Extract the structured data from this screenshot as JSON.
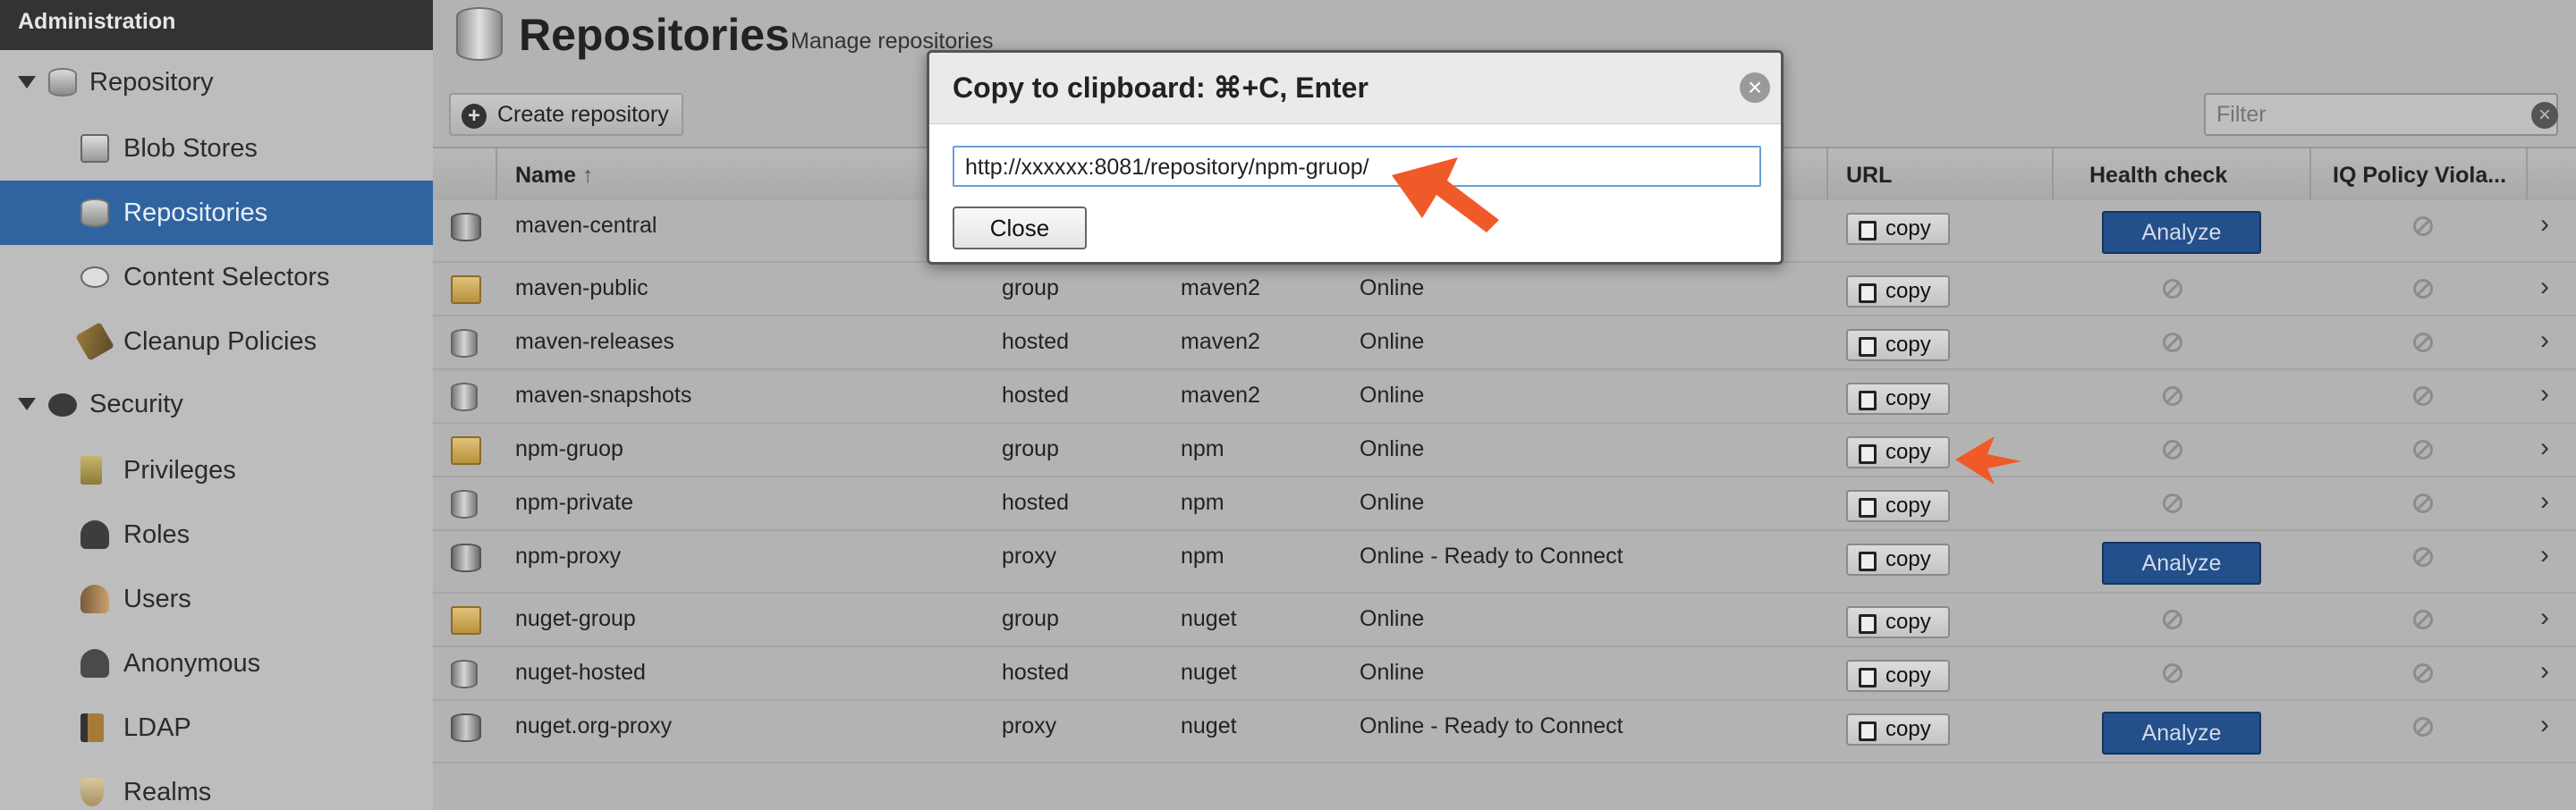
{
  "sidebar": {
    "header": "Administration",
    "repository_group": "Repository",
    "items_repo": [
      "Blob Stores",
      "Repositories",
      "Content Selectors",
      "Cleanup Policies"
    ],
    "security_group": "Security",
    "items_security": [
      "Privileges",
      "Roles",
      "Users",
      "Anonymous",
      "LDAP",
      "Realms"
    ]
  },
  "page": {
    "title": "Repositories",
    "subtitle": "Manage repositories",
    "create_button": "Create repository",
    "filter_placeholder": "Filter"
  },
  "grid": {
    "headers": {
      "name": "Name",
      "url": "URL",
      "health": "Health check",
      "iq": "IQ Policy Viola..."
    },
    "copy_label": "copy",
    "analyze_label": "Analyze",
    "rows": [
      {
        "name": "maven-central",
        "type": "",
        "format": "",
        "status": "",
        "kind": "proxy"
      },
      {
        "name": "maven-public",
        "type": "group",
        "format": "maven2",
        "status": "Online",
        "kind": "group"
      },
      {
        "name": "maven-releases",
        "type": "hosted",
        "format": "maven2",
        "status": "Online",
        "kind": "host"
      },
      {
        "name": "maven-snapshots",
        "type": "hosted",
        "format": "maven2",
        "status": "Online",
        "kind": "host"
      },
      {
        "name": "npm-gruop",
        "type": "group",
        "format": "npm",
        "status": "Online",
        "kind": "group"
      },
      {
        "name": "npm-private",
        "type": "hosted",
        "format": "npm",
        "status": "Online",
        "kind": "host"
      },
      {
        "name": "npm-proxy",
        "type": "proxy",
        "format": "npm",
        "status": "Online - Ready to Connect",
        "kind": "proxy"
      },
      {
        "name": "nuget-group",
        "type": "group",
        "format": "nuget",
        "status": "Online",
        "kind": "group"
      },
      {
        "name": "nuget-hosted",
        "type": "hosted",
        "format": "nuget",
        "status": "Online",
        "kind": "host"
      },
      {
        "name": "nuget.org-proxy",
        "type": "proxy",
        "format": "nuget",
        "status": "Online - Ready to Connect",
        "kind": "proxy"
      }
    ]
  },
  "modal": {
    "title": "Copy to clipboard: ⌘+C, Enter",
    "url_value": "http://xxxxxx:8081/repository/npm-gruop/",
    "close_button": "Close"
  },
  "colors": {
    "selected_nav": "#2f64a1",
    "analyze_button": "#234f8a",
    "annotation_arrow": "#f05a28"
  }
}
